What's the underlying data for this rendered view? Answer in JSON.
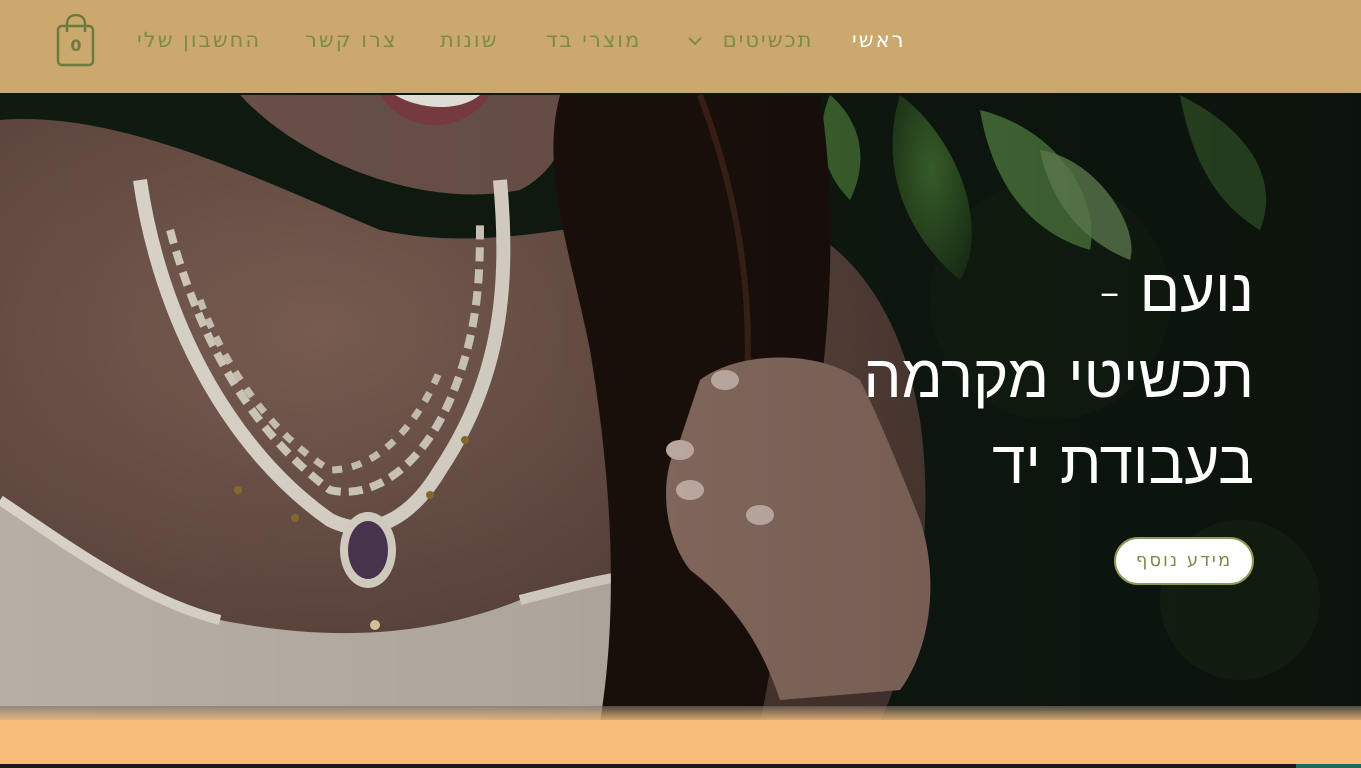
{
  "header": {
    "cart": {
      "count": "0",
      "icon": "shopping-bag-icon"
    },
    "nav": [
      {
        "key": "home",
        "label": "ראשי",
        "active": true
      },
      {
        "key": "jewelry",
        "label": "תכשיטים",
        "has_dropdown": true
      },
      {
        "key": "fabric",
        "label": "מוצרי בד"
      },
      {
        "key": "misc",
        "label": "שונות"
      },
      {
        "key": "contact",
        "label": "צרו קשר"
      },
      {
        "key": "account",
        "label": "החשבון שלי"
      }
    ]
  },
  "hero": {
    "title_lines": [
      "נועם -",
      "תכשיטי מקרמה",
      "בעבודת יד"
    ],
    "cta_label": "מידע נוסף"
  },
  "colors": {
    "header_bg": "#f5c882",
    "nav_text": "#7f8a48",
    "nav_active": "#ffffff",
    "button_border": "#8c9a55",
    "band": "#f7bd78"
  }
}
